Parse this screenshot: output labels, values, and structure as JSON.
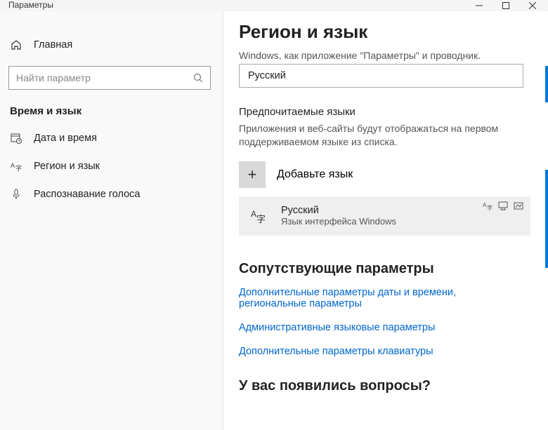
{
  "titlebar": {
    "title": "Параметры"
  },
  "sidebar": {
    "home_label": "Главная",
    "search_placeholder": "Найти параметр",
    "group_header": "Время и язык",
    "items": [
      {
        "label": "Дата и время"
      },
      {
        "label": "Регион и язык"
      },
      {
        "label": "Распознавание голоса"
      }
    ]
  },
  "main": {
    "title": "Регион и язык",
    "truncated_desc": "Windows, как приложение \"Параметры\" и проводник.",
    "display_lang_value": "Русский",
    "pref_langs_header": "Предпочитаемые языки",
    "pref_langs_desc": "Приложения и веб-сайты будут отображаться на первом поддерживаемом языке из списка.",
    "add_lang_label": "Добавьте язык",
    "lang_card": {
      "name": "Русский",
      "sub": "Язык интерфейса Windows"
    },
    "related_header": "Сопутствующие параметры",
    "links": [
      "Дополнительные параметры даты и времени, региональные параметры",
      "Административные языковые параметры",
      "Дополнительные параметры клавиатуры"
    ],
    "faq_header": "У вас появились вопросы?"
  }
}
